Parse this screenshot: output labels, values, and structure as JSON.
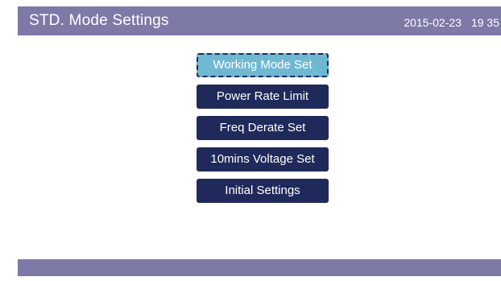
{
  "header": {
    "title": "STD. Mode Settings",
    "date": "2015-02-23",
    "time": "19 35"
  },
  "menu": {
    "items": [
      {
        "label": "Working Mode Set",
        "selected": true
      },
      {
        "label": "Power Rate Limit",
        "selected": false
      },
      {
        "label": "Freq Derate Set",
        "selected": false
      },
      {
        "label": "10mins Voltage Set",
        "selected": false
      },
      {
        "label": "Initial Settings",
        "selected": false
      }
    ]
  },
  "colors": {
    "header_bar": "#7d7aa8",
    "button": "#1f2a5a",
    "selected_button": "#6fb8d2",
    "text": "#ffffff"
  }
}
